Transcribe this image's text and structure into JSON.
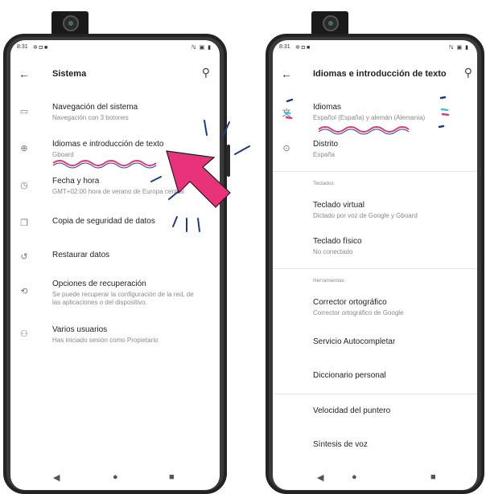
{
  "left_phone": {
    "status_time": "8:31",
    "status_icons_left": "✲ ◘ ■",
    "status_icons_right": "ℕ ▣ ▮",
    "title": "Sistema",
    "items": [
      {
        "title": "Navegación del sistema",
        "subtitle": "Navegación con 3 botones",
        "icon": "phone-outline-icon"
      },
      {
        "title": "Idiomas e introducción de texto",
        "subtitle": "Gboard",
        "icon": "globe-icon"
      },
      {
        "title": "Fecha y hora",
        "subtitle": "GMT+02:00 hora de verano de Europa central",
        "icon": "clock-icon"
      },
      {
        "title": "Copia de seguridad de datos",
        "subtitle": "",
        "icon": "backup-icon"
      },
      {
        "title": "Restaurar datos",
        "subtitle": "",
        "icon": "restore-icon"
      },
      {
        "title": "Opciones de recuperación",
        "subtitle": "Se puede recuperar la configuración de la red, de las aplicaciones o del dispositivo.",
        "icon": "history-icon"
      },
      {
        "title": "Varios usuarios",
        "subtitle": "Has iniciado sesión como Propietario",
        "icon": "users-icon"
      }
    ]
  },
  "right_phone": {
    "status_time": "8:31",
    "status_icons_left": "✲ ◘ ■",
    "status_icons_right": "ℕ ▣ ▮",
    "title": "Idiomas e introducción de texto",
    "top_items": [
      {
        "title": "Idiomas",
        "subtitle": "Español (España) y alemán (Alemania)",
        "icon": "translate-icon"
      },
      {
        "title": "Distrito",
        "subtitle": "España",
        "icon": "location-icon"
      }
    ],
    "section_keyboards": "Teclados",
    "keyboard_items": [
      {
        "title": "Teclado virtual",
        "subtitle": "Dictado por voz de Google y Gboard"
      },
      {
        "title": "Teclado físico",
        "subtitle": "No conectado"
      }
    ],
    "section_tools": "Herramientas",
    "tool_items": [
      {
        "title": "Corrector ortográfico",
        "subtitle": "Corrector ortográfico de Google"
      },
      {
        "title": "Servicio Autocompletar",
        "subtitle": ""
      },
      {
        "title": "Diccionario personal",
        "subtitle": ""
      }
    ],
    "bottom_items": [
      {
        "title": "Velocidad del puntero"
      },
      {
        "title": "Síntesis de voz"
      }
    ]
  },
  "nav": {
    "back": "◀",
    "home": "●",
    "recents": "■"
  },
  "icons": {
    "back": "←",
    "search": "⚲"
  },
  "colors": {
    "annotation_pink": "#e8327a",
    "annotation_blue": "#1f3a8a",
    "annotation_cyan": "#3bc3e0"
  }
}
